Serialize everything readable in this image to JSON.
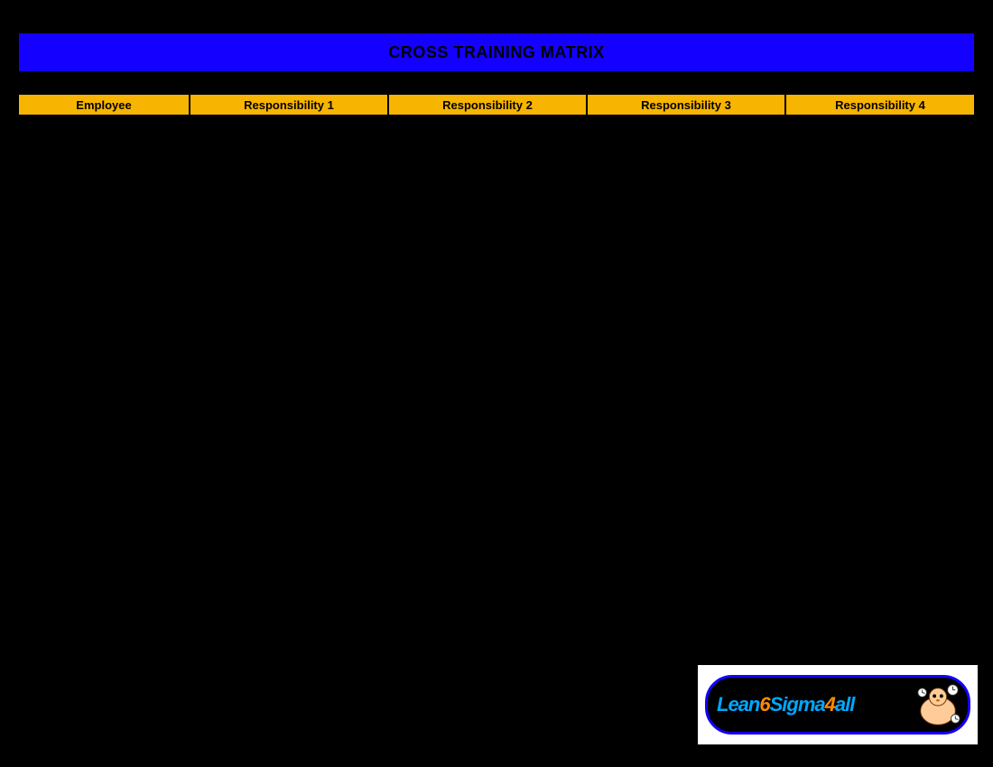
{
  "title": "CROSS TRAINING MATRIX",
  "columns": {
    "employee": "Employee",
    "r1": "Responsibility 1",
    "r2": "Responsibility 2",
    "r3": "Responsibility 3",
    "r4": "Responsibility 4"
  },
  "logo": {
    "t1": "Lean",
    "t2": "6",
    "t3": "Sigma",
    "t4": "4",
    "t5": "all"
  },
  "colors": {
    "title_band": "#1300ff",
    "header_cell": "#f7b400",
    "logo_blue": "#00a8ff",
    "logo_orange": "#ff8a00"
  }
}
